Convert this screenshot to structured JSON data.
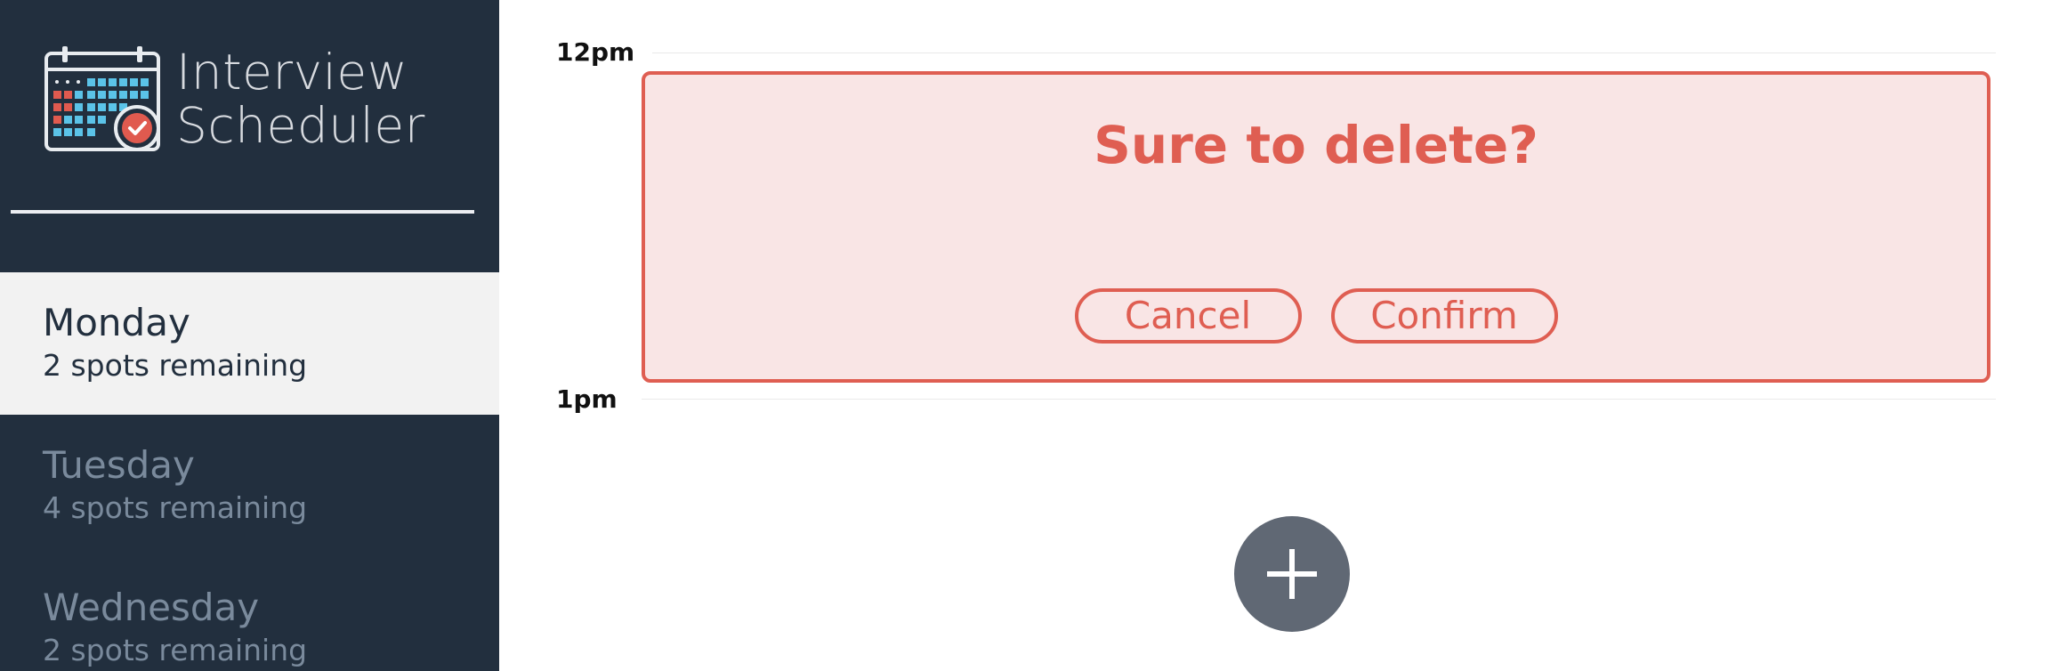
{
  "app": {
    "title_line1": "Interview",
    "title_line2": "Scheduler",
    "logo_icon": "calendar-check-icon"
  },
  "sidebar": {
    "days": [
      {
        "name": "Monday",
        "spots": "2 spots remaining",
        "selected": true
      },
      {
        "name": "Tuesday",
        "spots": "4 spots remaining",
        "selected": false
      },
      {
        "name": "Wednesday",
        "spots": "2 spots remaining",
        "selected": false
      }
    ]
  },
  "schedule": {
    "times": [
      "12pm",
      "1pm"
    ],
    "appointment": {
      "message": "Sure to delete?",
      "cancel_label": "Cancel",
      "confirm_label": "Confirm"
    },
    "add_icon": "plus-icon"
  },
  "colors": {
    "sidebar_bg": "#222f3e",
    "selected_day_bg": "#f2f2f2",
    "danger": "#df5e52",
    "danger_bg": "#f9e5e5",
    "add_button_bg": "#606874"
  }
}
